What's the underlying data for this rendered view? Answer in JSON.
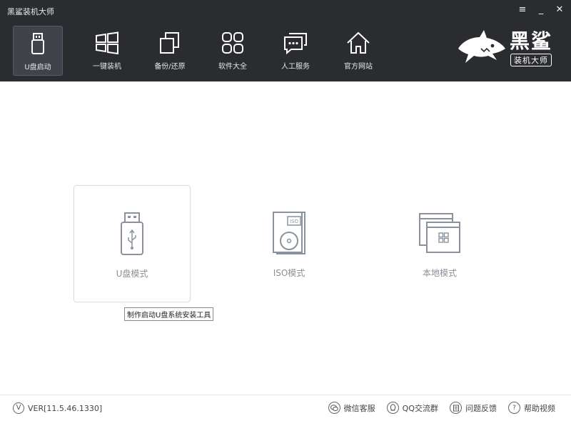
{
  "window": {
    "title": "黑鲨装机大师",
    "controls": {
      "menu": "≡",
      "minimize": "_",
      "close": "✕"
    }
  },
  "nav": {
    "items": [
      {
        "label": "U盘启动",
        "icon": "usb-drive-icon",
        "active": true
      },
      {
        "label": "一键装机",
        "icon": "windows-icon",
        "active": false
      },
      {
        "label": "备份/还原",
        "icon": "backup-restore-icon",
        "active": false
      },
      {
        "label": "软件大全",
        "icon": "apps-grid-icon",
        "active": false
      },
      {
        "label": "人工服务",
        "icon": "chat-bubble-icon",
        "active": false
      },
      {
        "label": "官方网站",
        "icon": "home-icon",
        "active": false
      }
    ]
  },
  "brand": {
    "name": "黑鲨",
    "tagline": "装机大师",
    "logo_icon": "shark-logo-icon"
  },
  "modes": [
    {
      "label": "U盘模式",
      "icon": "usb-mode-icon",
      "selected": true
    },
    {
      "label": "ISO模式",
      "icon": "iso-disc-icon",
      "selected": false
    },
    {
      "label": "本地模式",
      "icon": "local-windows-icon",
      "selected": false
    }
  ],
  "tooltip": {
    "text": "制作启动U盘系统安装工具"
  },
  "footer": {
    "version_icon": "V",
    "version": "VER[11.5.46.1330]",
    "links": [
      {
        "label": "微信客服",
        "icon": "wechat-icon"
      },
      {
        "label": "QQ交流群",
        "icon": "qq-icon"
      },
      {
        "label": "问题反馈",
        "icon": "feedback-icon"
      },
      {
        "label": "帮助视频",
        "icon": "help-icon"
      }
    ]
  },
  "colors": {
    "header_bg": "#2a2c30",
    "icon_white": "#ffffff",
    "mode_icon": "#8a939d"
  }
}
